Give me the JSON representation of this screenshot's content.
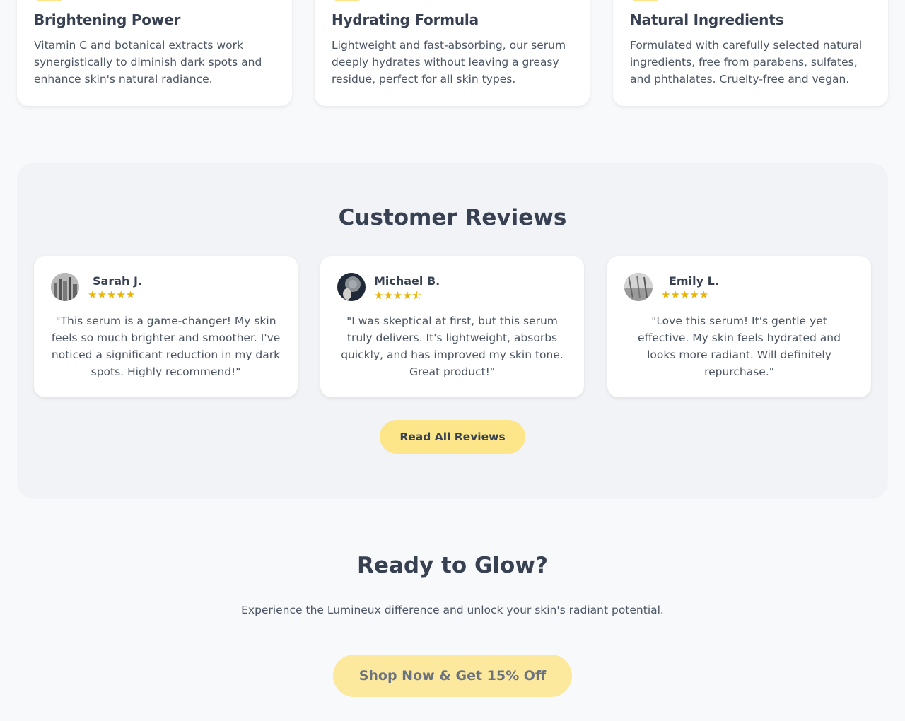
{
  "colors": {
    "accent": "#fde68a",
    "star": "#eab308",
    "text": "#374151",
    "muted": "#4b5563",
    "section_bg": "#f1f3f6",
    "page_bg": "#f8f9fb"
  },
  "features": [
    {
      "title": "Brightening Power",
      "description": "Vitamin C and botanical extracts work synergistically to diminish dark spots and enhance skin's natural radiance."
    },
    {
      "title": "Hydrating Formula",
      "description": "Lightweight and fast-absorbing, our serum deeply hydrates without leaving a greasy residue, perfect for all skin types."
    },
    {
      "title": "Natural Ingredients",
      "description": "Formulated with carefully selected natural ingredients, free from parabens, sulfates, and phthalates. Cruelty-free and vegan."
    }
  ],
  "reviews": {
    "title": "Customer Reviews",
    "items": [
      {
        "name": "Sarah J.",
        "rating": 5,
        "stars": "★★★★★",
        "text": "\"This serum is a game-changer! My skin feels so much brighter and smoother. I've noticed a significant reduction in my dark spots. Highly recommend!\""
      },
      {
        "name": "Michael B.",
        "rating": 4.5,
        "stars": "★★★★⯪",
        "text": "\"I was skeptical at first, but this serum truly delivers. It's lightweight, absorbs quickly, and has improved my skin tone. Great product!\""
      },
      {
        "name": "Emily L.",
        "rating": 5,
        "stars": "★★★★★",
        "text": "\"Love this serum! It's gentle yet effective. My skin feels hydrated and looks more radiant. Will definitely repurchase.\""
      }
    ],
    "read_all_label": "Read All Reviews"
  },
  "cta": {
    "title": "Ready to Glow?",
    "subtitle": "Experience the Lumineux difference and unlock your skin's radiant potential.",
    "button_label": "Shop Now & Get 15% Off"
  }
}
